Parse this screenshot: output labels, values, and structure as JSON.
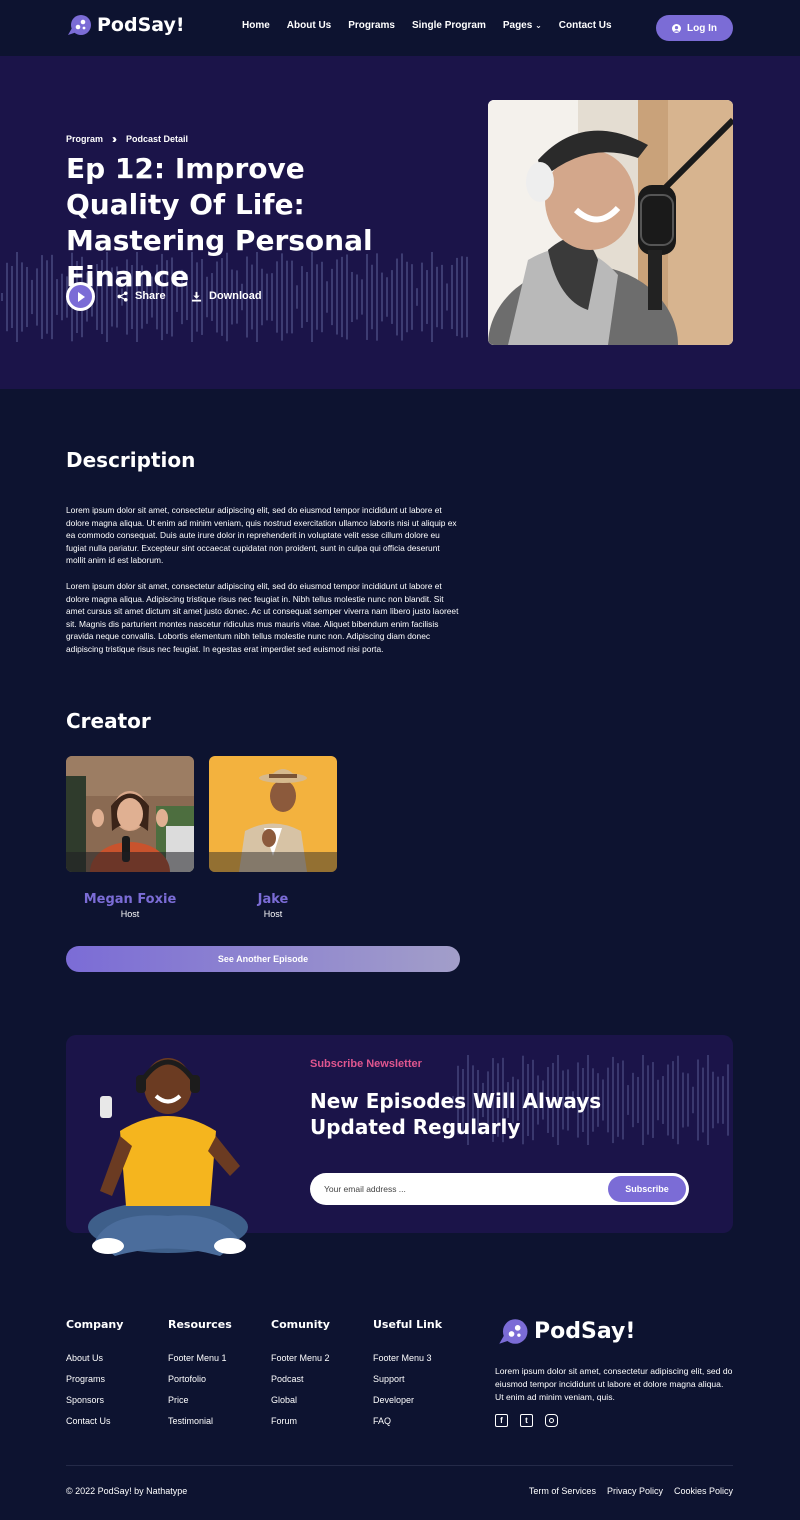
{
  "brand": {
    "name": "PodSay!"
  },
  "nav": {
    "links": [
      "Home",
      "About Us",
      "Programs",
      "Single Program",
      "Pages",
      "Contact Us"
    ],
    "login_label": "Log In"
  },
  "hero": {
    "breadcrumb": [
      "Program",
      "Podcast Detail"
    ],
    "title": "Ep 12: Improve Quality Of Life: Mastering Personal Finance",
    "share_label": "Share",
    "download_label": "Download"
  },
  "description": {
    "heading": "Description",
    "paragraphs": [
      "Lorem ipsum dolor sit amet, consectetur adipiscing elit, sed do eiusmod tempor incididunt ut labore et dolore magna aliqua. Ut enim ad minim veniam, quis nostrud exercitation ullamco laboris nisi ut aliquip ex ea commodo consequat. Duis aute irure dolor in reprehenderit in voluptate velit esse cillum dolore eu fugiat nulla pariatur. Excepteur sint occaecat cupidatat non proident, sunt in culpa qui officia deserunt mollit anim id est laborum.",
      "Lorem ipsum dolor sit amet, consectetur adipiscing elit, sed do eiusmod tempor incididunt ut labore et dolore magna aliqua. Adipiscing tristique risus nec feugiat in. Nibh tellus molestie nunc non blandit. Sit amet cursus sit amet dictum sit amet justo donec. Ac ut consequat semper viverra nam libero justo laoreet sit. Magnis dis parturient montes nascetur ridiculus mus mauris vitae. Aliquet bibendum enim facilisis gravida neque convallis. Lobortis elementum nibh tellus molestie nunc non. Adipiscing diam donec adipiscing tristique risus nec feugiat. In egestas erat imperdiet sed euismod nisi porta."
    ]
  },
  "creators": {
    "heading": "Creator",
    "items": [
      {
        "name": "Megan Foxie",
        "role": "Host"
      },
      {
        "name": "Jake",
        "role": "Host"
      }
    ],
    "cta_label": "See Another Episode"
  },
  "newsletter": {
    "kicker": "Subscribe Newsletter",
    "title": "New Episodes Will Always Updated Regularly",
    "placeholder": "Your email address ...",
    "button_label": "Subscribe"
  },
  "footer": {
    "columns": [
      {
        "heading": "Company",
        "links": [
          "About Us",
          "Programs",
          "Sponsors",
          "Contact Us"
        ]
      },
      {
        "heading": "Resources",
        "links": [
          "Footer Menu 1",
          "Portofolio",
          "Price",
          "Testimonial"
        ]
      },
      {
        "heading": "Comunity",
        "links": [
          "Footer Menu 2",
          "Podcast",
          "Global",
          "Forum"
        ]
      },
      {
        "heading": "Useful Link",
        "links": [
          "Footer Menu 3",
          "Support",
          "Developer",
          "FAQ"
        ]
      }
    ],
    "description": "Lorem ipsum dolor sit amet, consectetur adipiscing elit, sed do eiusmod tempor incididunt ut labore et dolore magna aliqua. Ut enim ad minim veniam, quis.",
    "socials": [
      "facebook-icon",
      "twitter-icon",
      "instagram-icon"
    ],
    "copyright": "© 2022 PodSay! by Nathatype",
    "legal_links": [
      "Term of Services",
      "Privacy Policy",
      "Cookies Policy"
    ]
  },
  "colors": {
    "background": "#0d1330",
    "hero": "#1b1449",
    "accent": "#7b6cd6",
    "kicker": "#e0568f"
  }
}
